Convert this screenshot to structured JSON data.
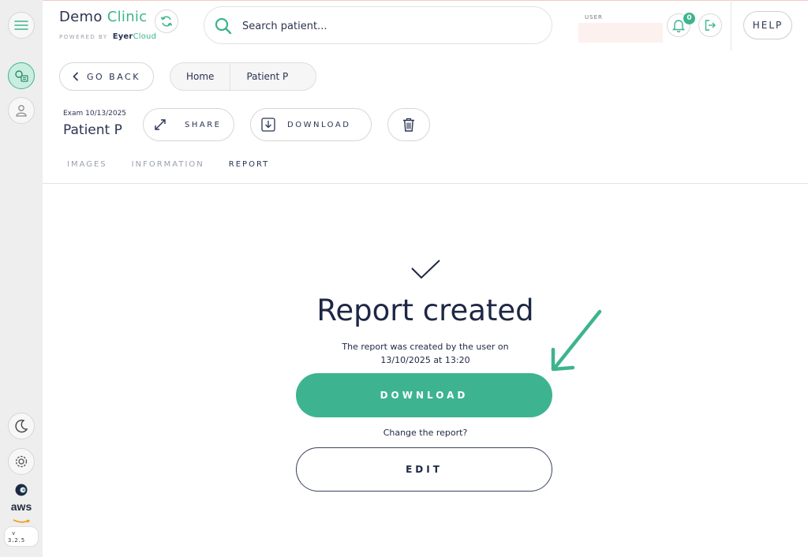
{
  "brand": {
    "title_part1": "Demo",
    "title_part2": "Clinic",
    "powered_by": "POWERED BY",
    "eyer": "Eyer",
    "cloud": "Cloud"
  },
  "search": {
    "placeholder": "Search patient..."
  },
  "header": {
    "user_label": "USER",
    "notification_count": "0",
    "help_label": "HELP"
  },
  "nav": {
    "back_label": "GO BACK",
    "breadcrumbs": [
      "Home",
      "Patient P"
    ]
  },
  "exam": {
    "date": "Exam 10/13/2025",
    "patient": "Patient P",
    "share_label": "SHARE",
    "download_label": "DOWNLOAD"
  },
  "tabs": [
    {
      "label": "IMAGES",
      "active": false
    },
    {
      "label": "INFORMATION",
      "active": false
    },
    {
      "label": "REPORT",
      "active": true
    }
  ],
  "report": {
    "title": "Report created",
    "desc_line1": "The report was created by the user on",
    "desc_line2": "13/10/2025 at 13:20",
    "download_label": "DOWNLOAD",
    "change_text": "Change the report?",
    "edit_label": "EDIT"
  },
  "sidebar": {
    "aws_label": "aws",
    "version_line1": "v",
    "version_line2": "3.2.5"
  },
  "colors": {
    "accent": "#3db48f",
    "text_dark": "#1e2744",
    "sidebar_bg": "#eeeeee"
  }
}
